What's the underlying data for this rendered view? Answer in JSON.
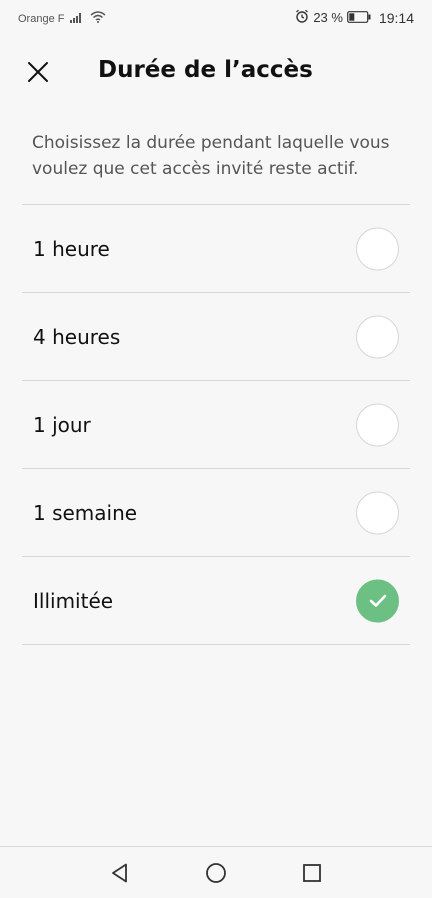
{
  "status_bar": {
    "carrier": "Orange F",
    "battery_percent": "23 %",
    "time": "19:14",
    "icons": [
      "signal-icon",
      "wifi-icon",
      "alarm-icon",
      "battery-icon"
    ]
  },
  "header": {
    "title": "Durée de l’accès",
    "close_icon": "close-icon"
  },
  "description": "Choisissez la durée pendant laquelle vous voulez que cet accès invité reste actif.",
  "options": [
    {
      "label": "1 heure",
      "selected": false
    },
    {
      "label": "4 heures",
      "selected": false
    },
    {
      "label": "1 jour",
      "selected": false
    },
    {
      "label": "1 semaine",
      "selected": false
    },
    {
      "label": "Illimitée",
      "selected": true
    }
  ],
  "nav_bar": {
    "icons": [
      "back-icon",
      "home-icon",
      "recent-apps-icon"
    ]
  },
  "colors": {
    "accent": "#6cc083",
    "background": "#f7f7f7",
    "divider": "#d8d8d8"
  }
}
